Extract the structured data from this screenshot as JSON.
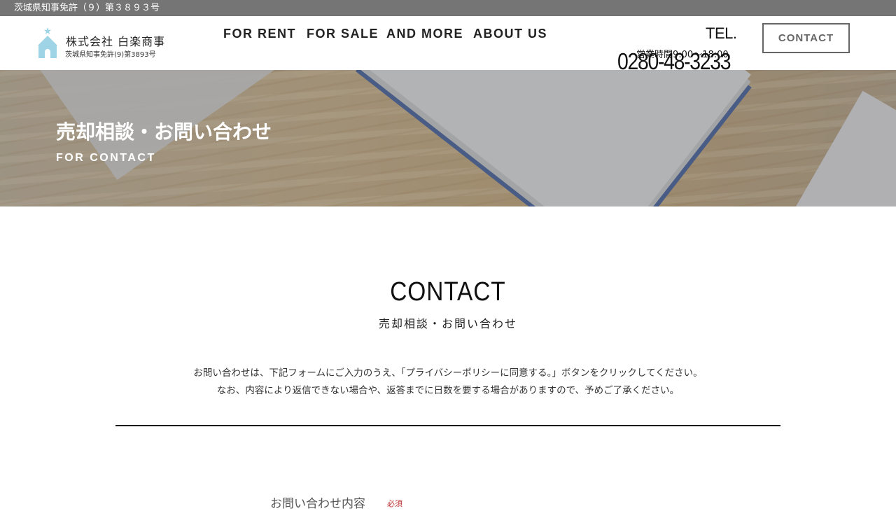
{
  "topbar": {
    "license": "茨城県知事免許（９）第３８９３号"
  },
  "header": {
    "logo_name": "株式会社 白楽商事",
    "logo_sub": "茨城県知事免許(9)第3893号",
    "nav": [
      "FOR RENT",
      "FOR SALE",
      "AND MORE",
      "ABOUT US"
    ],
    "tel_label": "TEL.",
    "hours": "営業時間9:00～18:00",
    "tel_number": "0280-48-3233",
    "contact_label": "CONTACT"
  },
  "hero": {
    "title": "売却相談・お問い合わせ",
    "subtitle": "FOR CONTACT"
  },
  "main": {
    "title": "CONTACT",
    "subtitle": "売却相談・お問い合わせ",
    "intro_lines": [
      "お問い合わせは、下記フォームにご入力のうえ、「プライバシーポリシーに同意する。」ボタンをクリックしてください。",
      "なお、内容により返信できない場合や、返答までに日数を要する場合がありますので、予めご了承ください。"
    ],
    "field_label": "お問い合わせ内容",
    "required": "必須"
  },
  "colors": {
    "topbar": "#757575",
    "text": "#222222",
    "required": "#bb3333",
    "logo_mark": "#9fd3e6"
  }
}
